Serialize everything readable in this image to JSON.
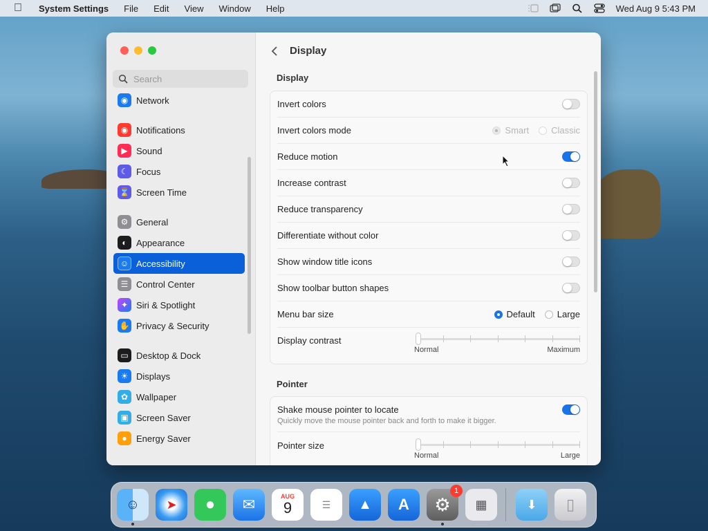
{
  "menubar": {
    "app_name": "System Settings",
    "menus": [
      "File",
      "Edit",
      "View",
      "Window",
      "Help"
    ],
    "clock": "Wed Aug 9  5:43 PM"
  },
  "sidebar": {
    "search_placeholder": "Search",
    "items": [
      {
        "label": "Network",
        "icon": "globe-icon",
        "color": "#1a7bf0"
      },
      {
        "label": "Notifications",
        "icon": "bell-icon",
        "color": "#ff3b30"
      },
      {
        "label": "Sound",
        "icon": "speaker-icon",
        "color": "#ff2d55"
      },
      {
        "label": "Focus",
        "icon": "moon-icon",
        "color": "#5e5ce6"
      },
      {
        "label": "Screen Time",
        "icon": "hourglass-icon",
        "color": "#5e5ce6"
      },
      {
        "label": "General",
        "icon": "gear-icon",
        "color": "#8e8e93"
      },
      {
        "label": "Appearance",
        "icon": "appearance-icon",
        "color": "#1c1c1e"
      },
      {
        "label": "Accessibility",
        "icon": "accessibility-icon",
        "color": "#1a7bf0"
      },
      {
        "label": "Control Center",
        "icon": "control-center-icon",
        "color": "#8e8e93"
      },
      {
        "label": "Siri & Spotlight",
        "icon": "siri-icon",
        "color": "#c644fc"
      },
      {
        "label": "Privacy & Security",
        "icon": "hand-icon",
        "color": "#1a7bf0"
      },
      {
        "label": "Desktop & Dock",
        "icon": "dock-icon",
        "color": "#1c1c1e"
      },
      {
        "label": "Displays",
        "icon": "sun-icon",
        "color": "#1a7bf0"
      },
      {
        "label": "Wallpaper",
        "icon": "flower-icon",
        "color": "#32ade6"
      },
      {
        "label": "Screen Saver",
        "icon": "screensaver-icon",
        "color": "#32ade6"
      },
      {
        "label": "Energy Saver",
        "icon": "bulb-icon",
        "color": "#ff9f0a"
      }
    ],
    "active_item": "Accessibility"
  },
  "main": {
    "title": "Display",
    "display_section": {
      "heading": "Display",
      "invert_colors": {
        "label": "Invert colors",
        "on": false
      },
      "invert_mode": {
        "label": "Invert colors mode",
        "options": [
          "Smart",
          "Classic"
        ],
        "selected": "Smart",
        "enabled": false
      },
      "reduce_motion": {
        "label": "Reduce motion",
        "on": true
      },
      "increase_contrast": {
        "label": "Increase contrast",
        "on": false
      },
      "reduce_transparency": {
        "label": "Reduce transparency",
        "on": false
      },
      "differentiate": {
        "label": "Differentiate without color",
        "on": false
      },
      "title_icons": {
        "label": "Show window title icons",
        "on": false
      },
      "toolbar_shapes": {
        "label": "Show toolbar button shapes",
        "on": false
      },
      "menu_bar_size": {
        "label": "Menu bar size",
        "options": [
          "Default",
          "Large"
        ],
        "selected": "Default"
      },
      "display_contrast": {
        "label": "Display contrast",
        "min_label": "Normal",
        "max_label": "Maximum",
        "value": 0
      }
    },
    "pointer_section": {
      "heading": "Pointer",
      "shake": {
        "label": "Shake mouse pointer to locate",
        "description": "Quickly move the mouse pointer back and forth to make it bigger.",
        "on": true
      },
      "pointer_size": {
        "label": "Pointer size",
        "min_label": "Normal",
        "max_label": "Large",
        "value": 0
      }
    }
  },
  "dock": {
    "calendar_month": "AUG",
    "calendar_day": "9",
    "settings_badge": "1",
    "apps": [
      "Finder",
      "Safari",
      "Messages",
      "Mail",
      "Calendar",
      "Reminders",
      "Keynote",
      "App Store",
      "System Settings",
      "Launchpad",
      "Downloads",
      "Trash"
    ]
  }
}
